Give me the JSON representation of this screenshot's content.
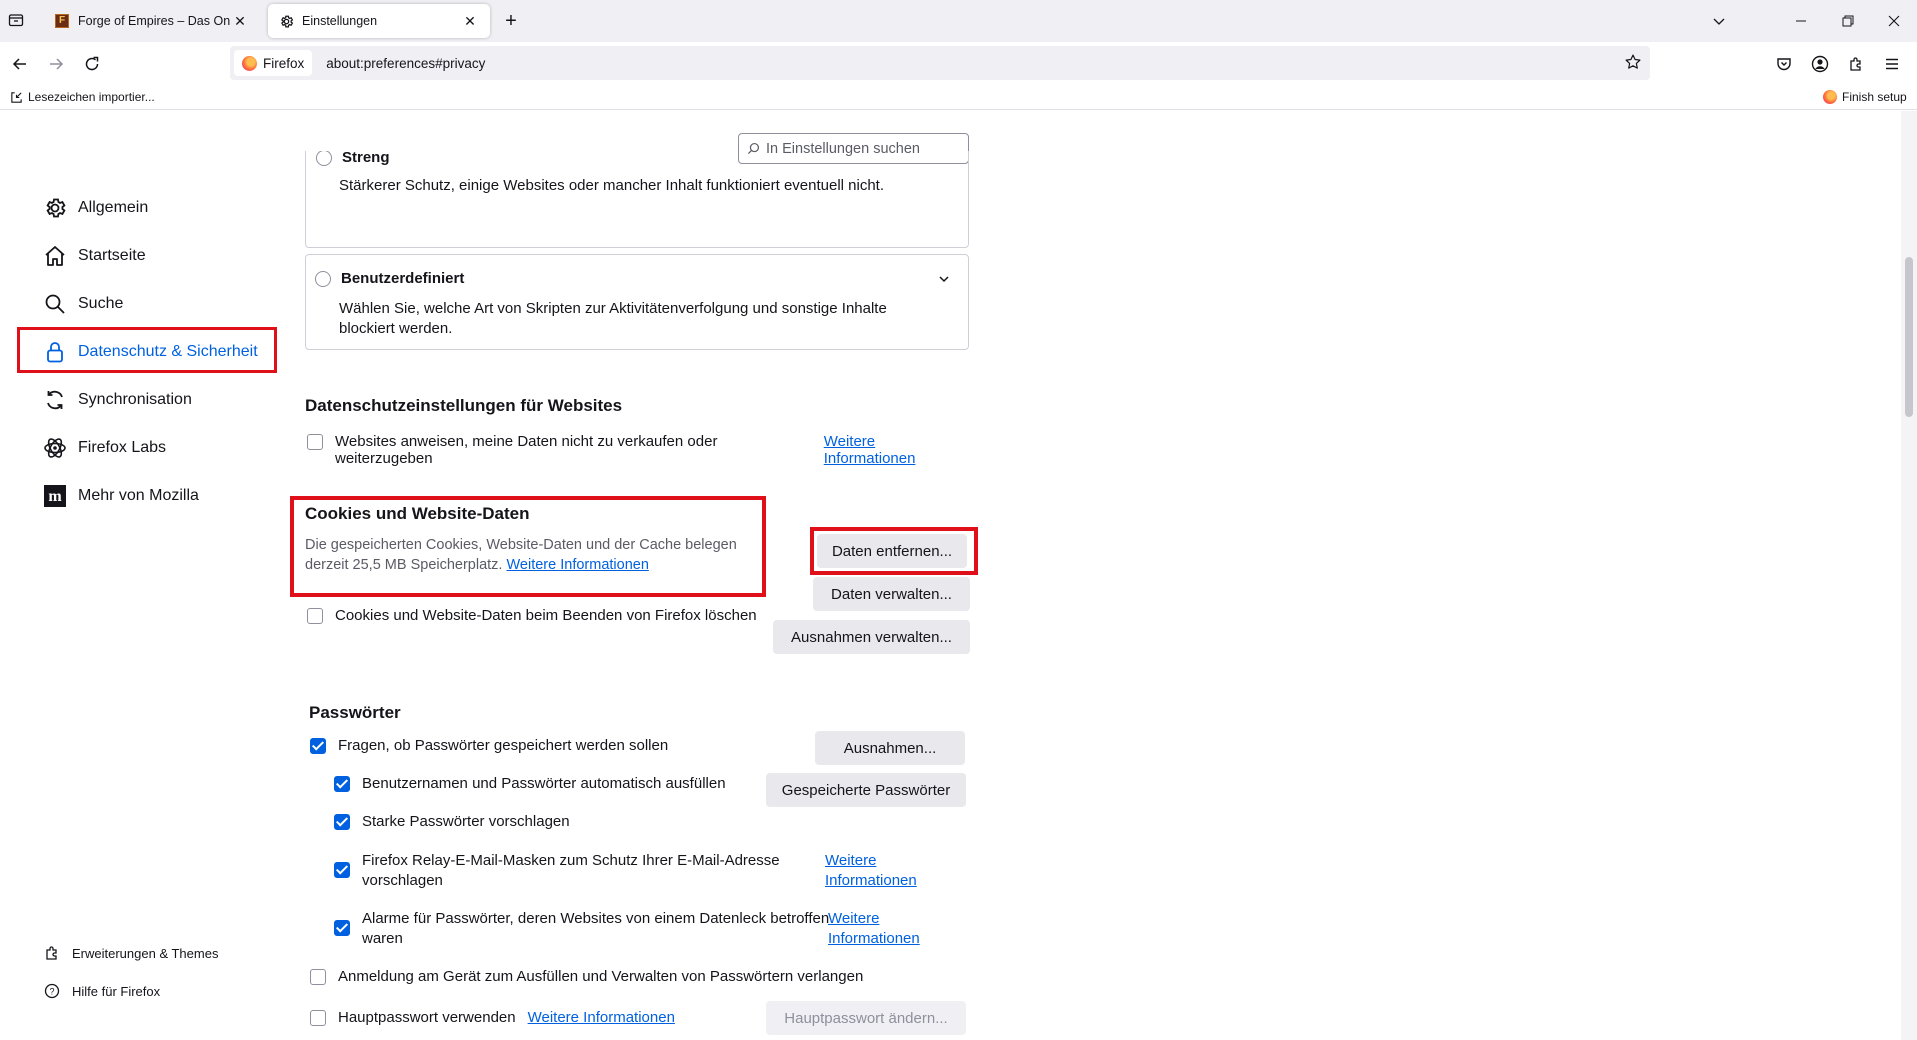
{
  "tabs": [
    {
      "label": "Forge of Empires – Das Online S",
      "icon": "forge-of-empires-favicon"
    },
    {
      "label": "Einstellungen",
      "icon": "gear-icon"
    }
  ],
  "navbar": {
    "identity_label": "Firefox",
    "url": "about:preferences#privacy"
  },
  "bookmarks": {
    "import_label": "Lesezeichen importier...",
    "finish_setup_label": "Finish setup"
  },
  "search": {
    "placeholder": "In Einstellungen suchen"
  },
  "sidebar": {
    "items": [
      {
        "label": "Allgemein",
        "icon": "gear-icon"
      },
      {
        "label": "Startseite",
        "icon": "home-icon"
      },
      {
        "label": "Suche",
        "icon": "search-icon"
      },
      {
        "label": "Datenschutz & Sicherheit",
        "icon": "lock-icon",
        "selected": true
      },
      {
        "label": "Synchronisation",
        "icon": "sync-icon"
      },
      {
        "label": "Firefox Labs",
        "icon": "labs-icon"
      },
      {
        "label": "Mehr von Mozilla",
        "icon": "mozilla-icon"
      }
    ],
    "footer": [
      {
        "label": "Erweiterungen & Themes",
        "icon": "puzzle-icon"
      },
      {
        "label": "Hilfe für Firefox",
        "icon": "help-icon"
      }
    ]
  },
  "tracking": {
    "strict_title": "Streng",
    "strict_desc": "Stärkerer Schutz, einige Websites oder mancher Inhalt funktioniert eventuell nicht.",
    "custom_title": "Benutzerdefiniert",
    "custom_desc": "Wählen Sie, welche Art von Skripten zur Aktivitätenverfolgung und sonstige Inhalte blockiert werden."
  },
  "website_privacy": {
    "heading": "Datenschutzeinstellungen für Websites",
    "gpc_label": "Websites anweisen, meine Daten nicht zu verkaufen oder weiterzugeben",
    "gpc_link": "Weitere Informationen"
  },
  "cookies": {
    "heading": "Cookies und Website-Daten",
    "desc_line1": "Die gespeicherten Cookies, Website-Daten und der Cache belegen",
    "desc_line2": "derzeit 25,5 MB Speicherplatz.",
    "desc_link": "Weitere Informationen",
    "clear_button": "Daten entfernen...",
    "manage_button": "Daten verwalten...",
    "exceptions_button": "Ausnahmen verwalten...",
    "delete_on_close_label": "Cookies und Website-Daten beim Beenden von Firefox löschen"
  },
  "passwords": {
    "heading": "Passwörter",
    "ask_save_label": "Fragen, ob Passwörter gespeichert werden sollen",
    "exceptions_button": "Ausnahmen...",
    "autofill_label": "Benutzernamen und Passwörter automatisch ausfüllen",
    "saved_button": "Gespeicherte Passwörter",
    "suggest_label": "Starke Passwörter vorschlagen",
    "relay_label_line1": "Firefox Relay-E-Mail-Masken zum Schutz Ihrer E-Mail-Adresse",
    "relay_label_line2": "vorschlagen",
    "relay_link_line1": "Weitere",
    "relay_link_line2": "Informationen",
    "breach_label_line1": "Alarme für Passwörter, deren Websites von einem Datenleck betroffen",
    "breach_label_line2": "waren",
    "breach_link_line1": "Weitere",
    "breach_link_line2": "Informationen",
    "device_login_label": "Anmeldung am Gerät zum Ausfüllen und Verwalten von Passwörtern verlangen",
    "primary_pw_label": "Hauptpasswort verwenden",
    "primary_pw_link": "Weitere Informationen",
    "primary_pw_button": "Hauptpasswort ändern..."
  },
  "colors": {
    "accent": "#0061e0",
    "highlight": "#e0101a"
  }
}
